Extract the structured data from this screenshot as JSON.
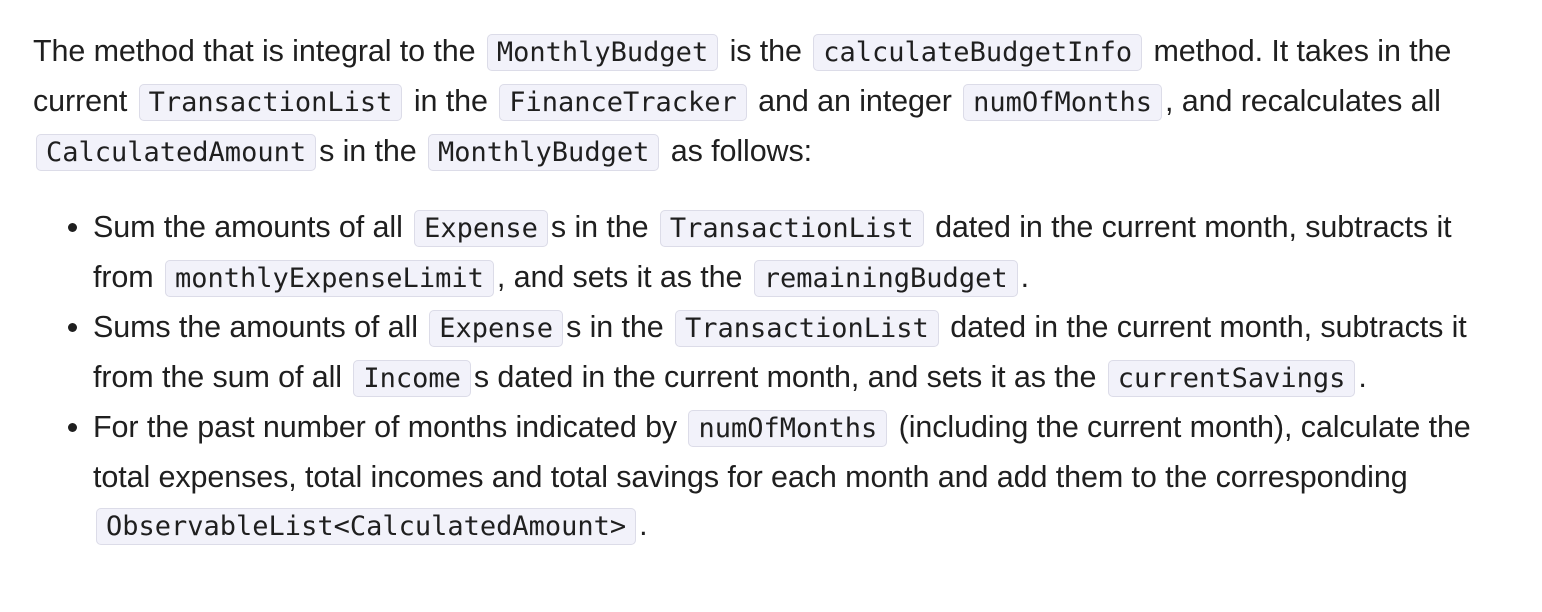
{
  "intro": {
    "t1": "The method that is integral to the",
    "c1": "MonthlyBudget",
    "t2": "is the",
    "c2": "calculateBudgetInfo",
    "t3": "method. It takes in the current",
    "c3": "TransactionList",
    "t4": "in the",
    "c4": "FinanceTracker",
    "t5": "and an integer",
    "c5": "numOfMonths",
    "t6": ", and recalculates all",
    "c6": "CalculatedAmount",
    "t7": "s in the",
    "c7": "MonthlyBudget",
    "t8": "as follows:"
  },
  "bullets": [
    {
      "t1": "Sum the amounts of all",
      "c1": "Expense",
      "t2": "s in the",
      "c2": "TransactionList",
      "t3": "dated in the current month, subtracts it from",
      "c3": "monthlyExpenseLimit",
      "t4": ", and sets it as the",
      "c4": "remainingBudget",
      "t5": "."
    },
    {
      "t1": "Sums the amounts of all",
      "c1": "Expense",
      "t2": "s in the",
      "c2": "TransactionList",
      "t3": "dated in the current month, subtracts it from the sum of all",
      "c3": "Income",
      "t4": "s dated in the current month, and sets it as the",
      "c4": "currentSavings",
      "t5": "."
    },
    {
      "t1": "For the past number of months indicated by",
      "c1": "numOfMonths",
      "t2": "(including the current month), calculate the total expenses, total incomes and total savings for each month and add them to the corresponding",
      "c2": "ObservableList<CalculatedAmount>",
      "t3": "."
    }
  ]
}
